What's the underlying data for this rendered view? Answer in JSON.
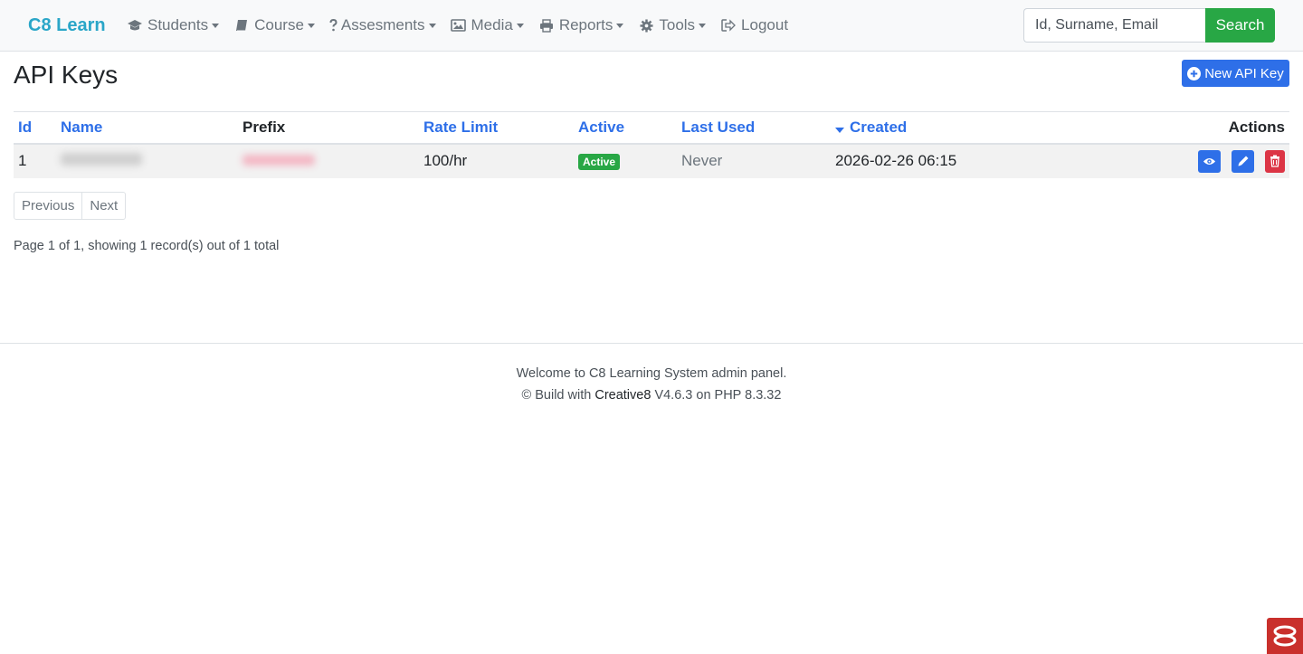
{
  "nav": {
    "brand": "C8 Learn",
    "items": [
      {
        "label": "Students",
        "icon": "graduation-cap-icon",
        "dropdown": true
      },
      {
        "label": "Course",
        "icon": "book-icon",
        "dropdown": true
      },
      {
        "label": "Assesments",
        "icon": "question-icon",
        "dropdown": true
      },
      {
        "label": "Media",
        "icon": "image-icon",
        "dropdown": true
      },
      {
        "label": "Reports",
        "icon": "print-icon",
        "dropdown": true
      },
      {
        "label": "Tools",
        "icon": "gear-icon",
        "dropdown": true
      },
      {
        "label": "Logout",
        "icon": "sign-out-icon",
        "dropdown": false
      }
    ],
    "search_placeholder": "Id, Surname, Email",
    "search_label": "Search"
  },
  "page": {
    "title": "API Keys",
    "new_button": "New API Key"
  },
  "table": {
    "columns": [
      {
        "label": "Id",
        "sortable": true
      },
      {
        "label": "Name",
        "sortable": true
      },
      {
        "label": "Prefix",
        "sortable": false
      },
      {
        "label": "Rate Limit",
        "sortable": true
      },
      {
        "label": "Active",
        "sortable": true
      },
      {
        "label": "Last Used",
        "sortable": true
      },
      {
        "label": "Created",
        "sortable": true,
        "sorted": "desc"
      },
      {
        "label": "Actions",
        "sortable": false
      }
    ],
    "rows": [
      {
        "id": "1",
        "rate_limit": "100/hr",
        "active": "Active",
        "last_used": "Never",
        "created": "2026-02-26 06:15"
      }
    ]
  },
  "pagination": {
    "previous": "Previous",
    "next": "Next",
    "info": "Page 1 of 1, showing 1 record(s) out of 1 total"
  },
  "footer": {
    "line1": "Welcome to C8 Learning System admin panel.",
    "line2_prefix": "© Build with",
    "brand": "Creative8",
    "line2_suffix": "V4.6.3 on PHP 8.3.32"
  },
  "colors": {
    "brand": "#2aa6c8",
    "primary": "#2e6fe8",
    "success": "#28a745",
    "danger": "#dc3545"
  }
}
